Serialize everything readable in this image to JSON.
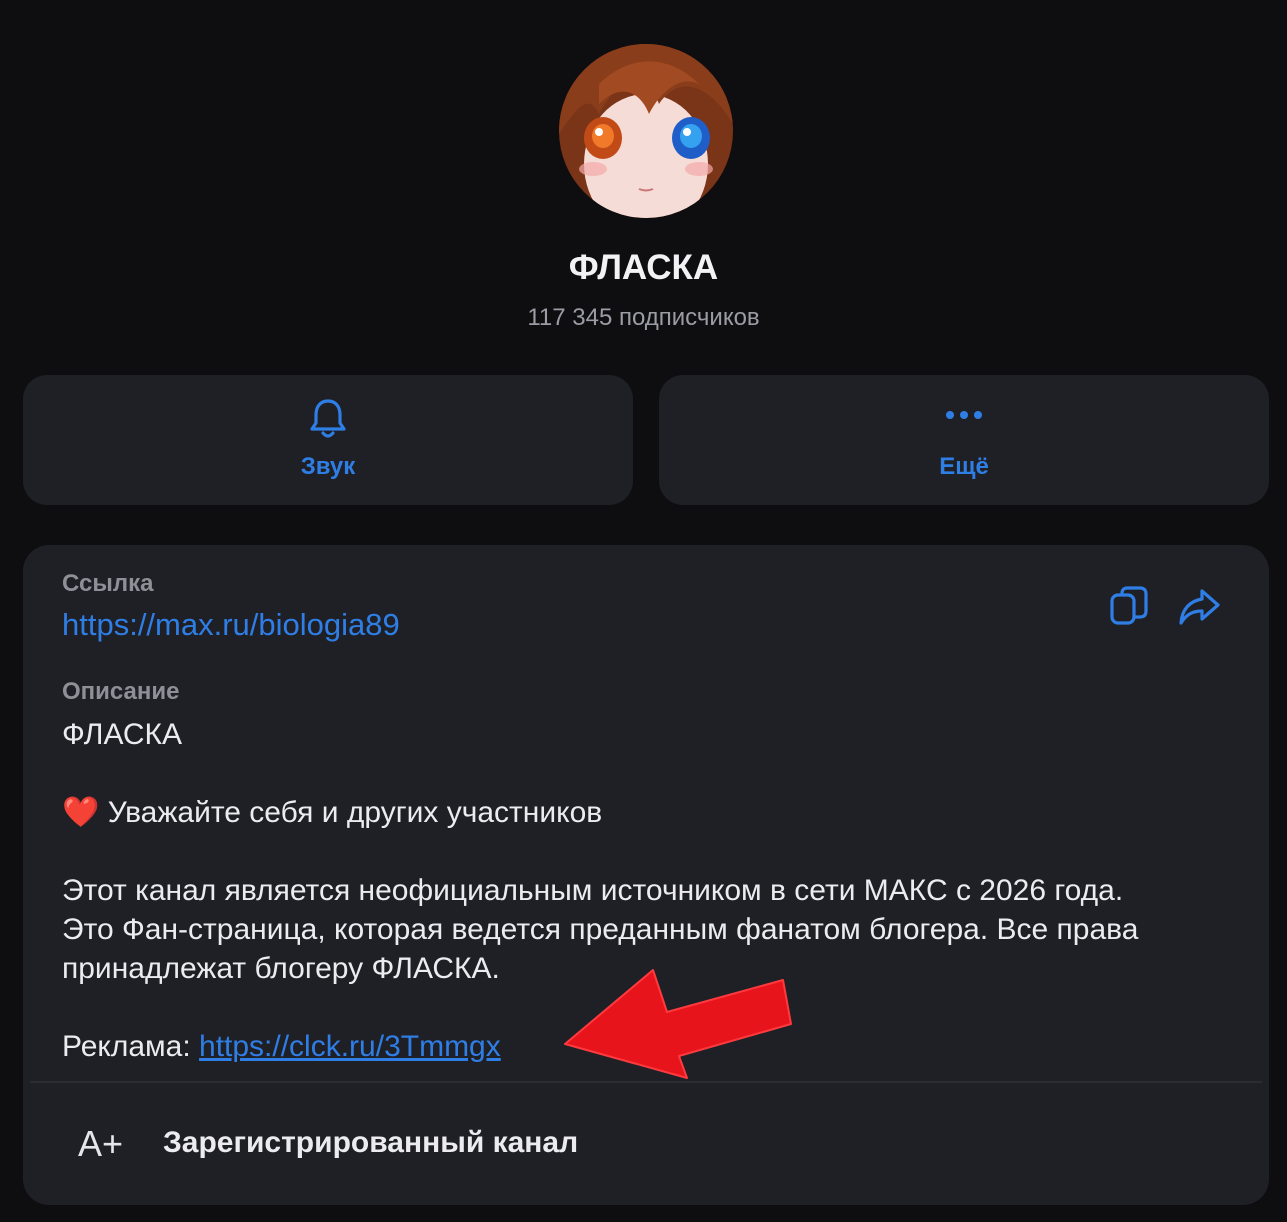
{
  "channel": {
    "title": "ФЛАСКА",
    "subscribers": "117 345 подписчиков"
  },
  "actions": {
    "sound": {
      "label": "Звук",
      "icon": "bell-icon"
    },
    "more": {
      "label": "Ещё",
      "icon": "more-dots-icon"
    }
  },
  "info": {
    "link_label": "Ссылка",
    "link_value": "https://max.ru/biologia89",
    "description_label": "Описание",
    "description_title": "ФЛАСКА",
    "rule_emoji": "❤️",
    "rule_text": "Уважайте себя и других участников",
    "about_line1": "Этот канал является неофициальным источником в сети МАКС с 2026 года.",
    "about_line2": "Это Фан-страница, которая ведется преданным фанатом блогера. Все права",
    "about_line3": "принадлежат блогеру ФЛАСКА.",
    "ad_prefix": "Реклама: ",
    "ad_link": "https://clck.ru/3Tmmgx"
  },
  "registered": {
    "label": "Зарегистрированный канал",
    "icon_text": "A+"
  },
  "colors": {
    "background": "#0e0e11",
    "card": "#1f2025",
    "accent": "#2f7ee6",
    "annotation_arrow": "#e8141c"
  }
}
